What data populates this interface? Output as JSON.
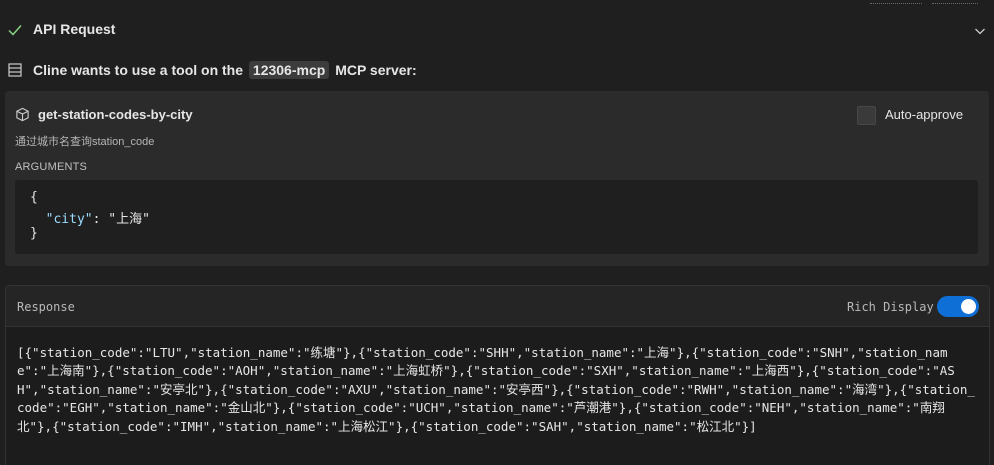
{
  "header": {
    "status_icon": "check-icon",
    "title": "API Request",
    "expand_icon": "chevron-down-icon"
  },
  "request": {
    "prefix": "Cline wants to use a tool on the",
    "server_name": "12306-mcp",
    "suffix": "MCP server:"
  },
  "tool": {
    "name": "get-station-codes-by-city",
    "description": "通过城市名查询station_code",
    "auto_approve_label": "Auto-approve",
    "auto_approve_checked": false,
    "arguments_label": "ARGUMENTS",
    "arguments": {
      "open": "{",
      "key": "\"city\"",
      "colon": ": ",
      "value": "\"上海\"",
      "close": "}"
    }
  },
  "response": {
    "label": "Response",
    "rich_display_label": "Rich Display",
    "rich_display_on": true,
    "body": "[{\"station_code\":\"LTU\",\"station_name\":\"练塘\"},{\"station_code\":\"SHH\",\"station_name\":\"上海\"},{\"station_code\":\"SNH\",\"station_name\":\"上海南\"},{\"station_code\":\"AOH\",\"station_name\":\"上海虹桥\"},{\"station_code\":\"SXH\",\"station_name\":\"上海西\"},{\"station_code\":\"ASH\",\"station_name\":\"安亭北\"},{\"station_code\":\"AXU\",\"station_name\":\"安亭西\"},{\"station_code\":\"RWH\",\"station_name\":\"海湾\"},{\"station_code\":\"EGH\",\"station_name\":\"金山北\"},{\"station_code\":\"UCH\",\"station_name\":\"芦潮港\"},{\"station_code\":\"NEH\",\"station_name\":\"南翔北\"},{\"station_code\":\"IMH\",\"station_name\":\"上海松江\"},{\"station_code\":\"SAH\",\"station_name\":\"松江北\"}]"
  },
  "colors": {
    "background": "#1f1f1f",
    "panel": "#2b2b2b",
    "accent": "#0e6fd6",
    "json_key": "#9cdcfe"
  }
}
